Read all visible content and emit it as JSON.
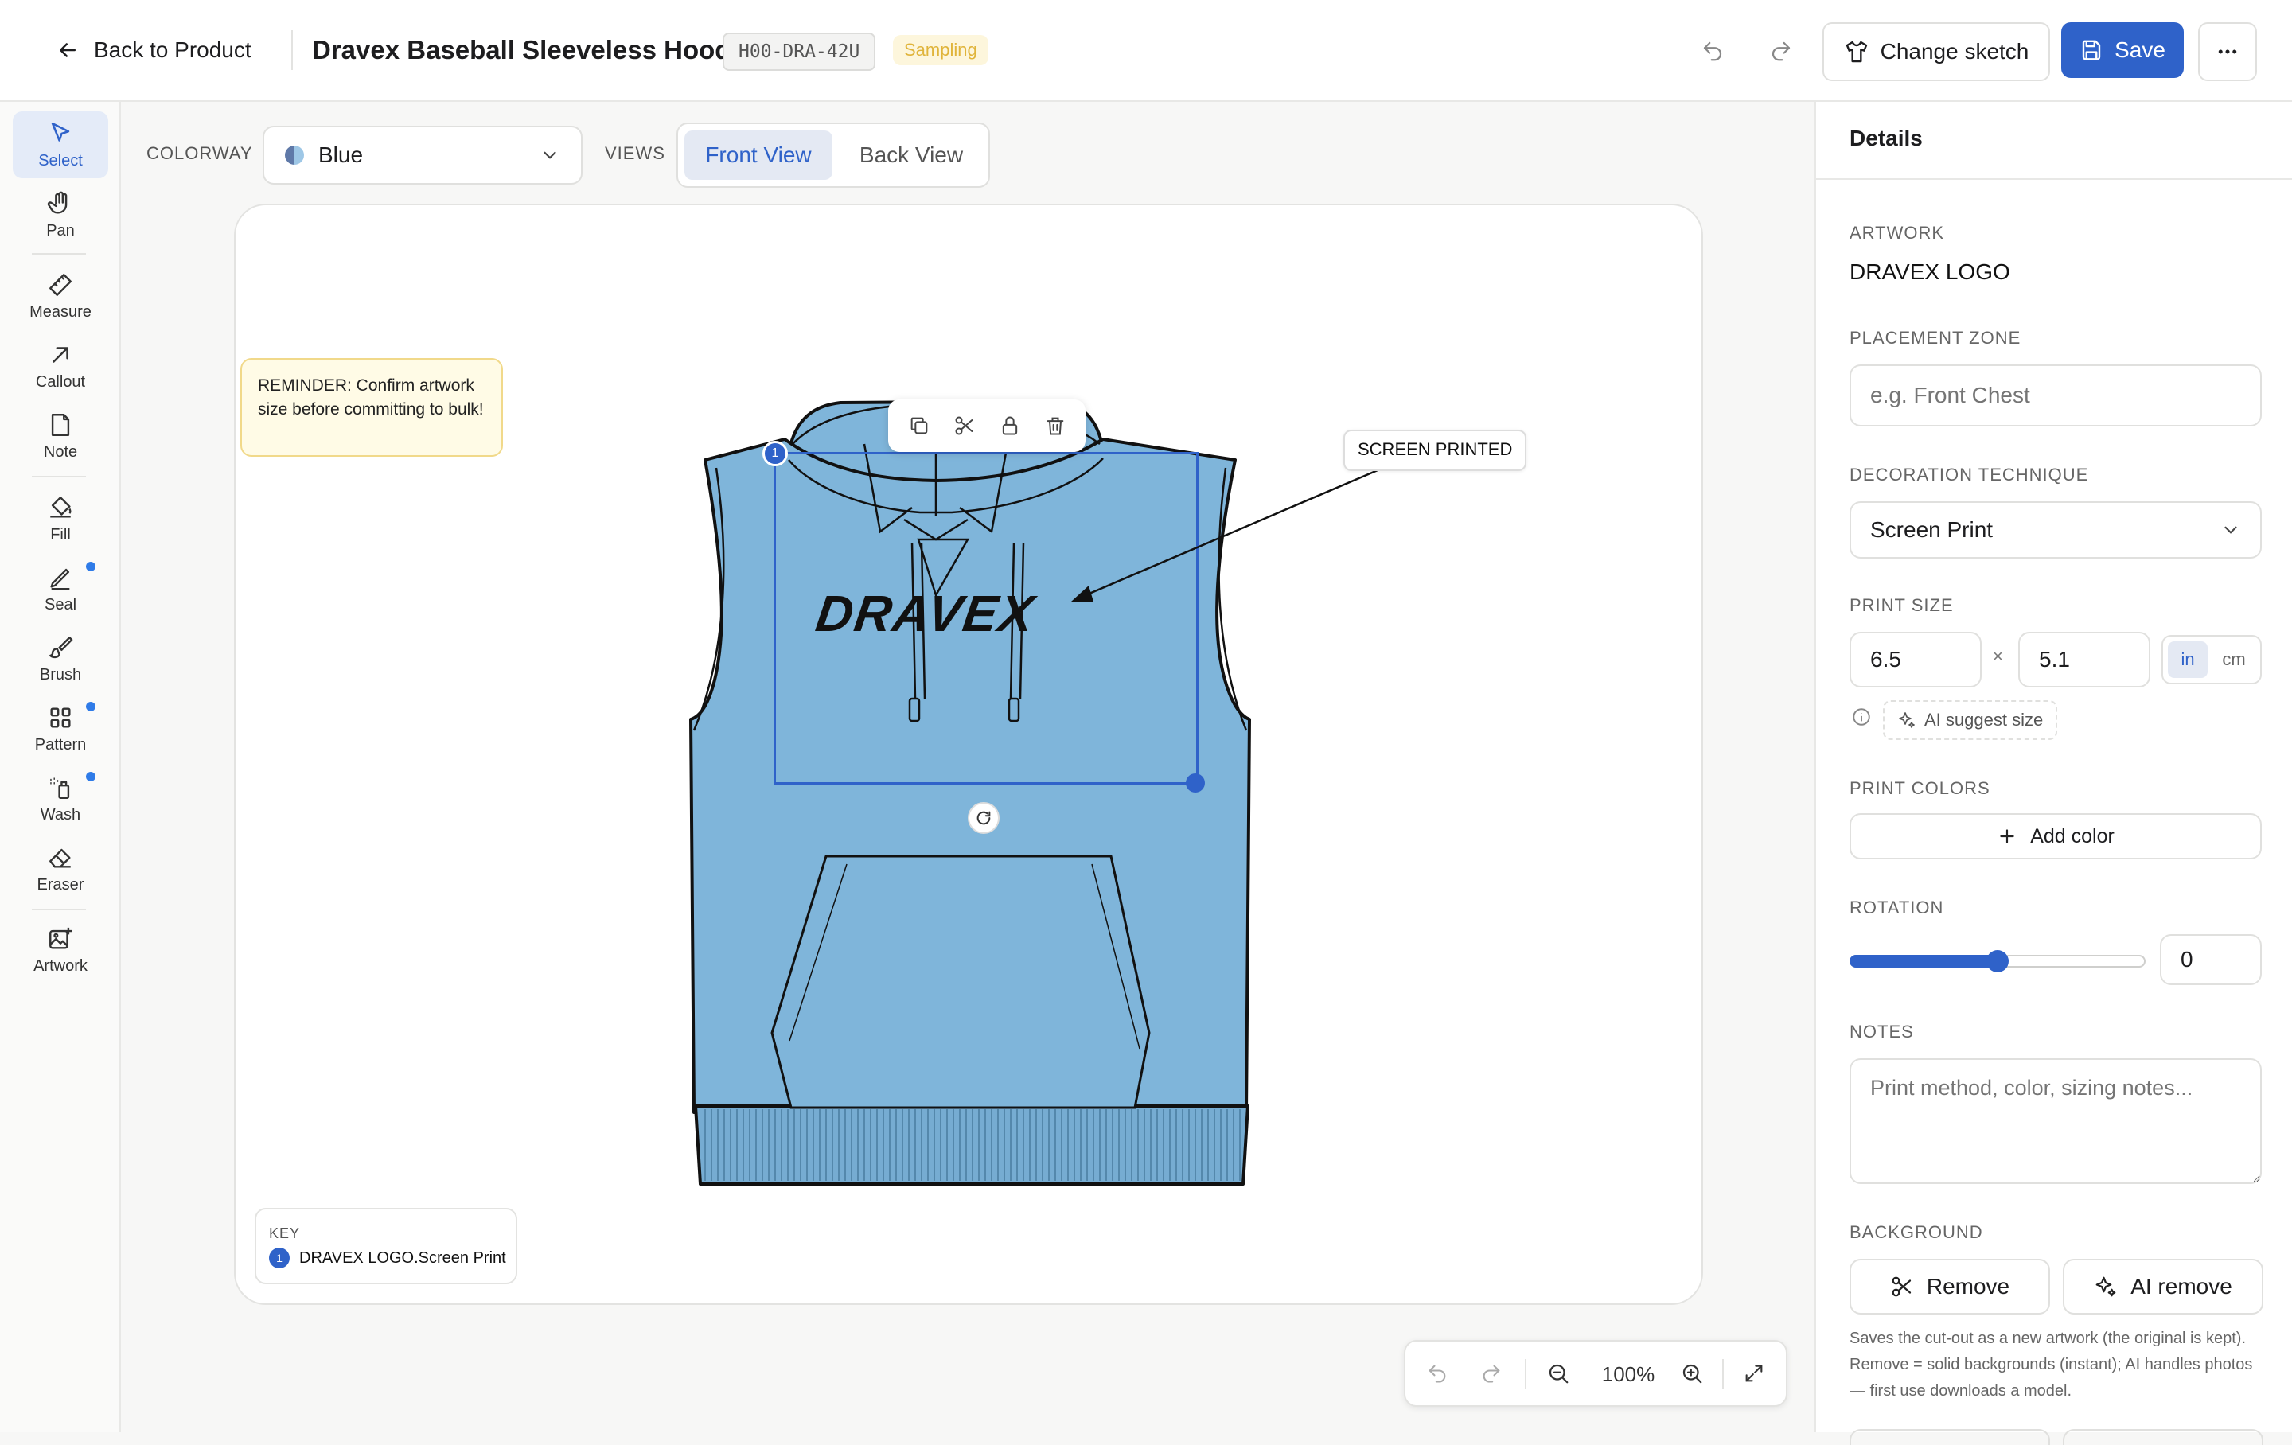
{
  "header": {
    "back_label": "Back to Product",
    "title": "Dravex Baseball Sleeveless Hoodie",
    "sku": "H00-DRA-42U",
    "status": "Sampling",
    "change_sketch_label": "Change sketch",
    "save_label": "Save"
  },
  "toolbar": {
    "tools": [
      {
        "label": "Select",
        "icon": "cursor-icon"
      },
      {
        "label": "Pan",
        "icon": "hand-icon"
      },
      {
        "label": "Measure",
        "icon": "ruler-icon"
      },
      {
        "label": "Callout",
        "icon": "arrow-icon"
      },
      {
        "label": "Note",
        "icon": "note-icon"
      },
      {
        "label": "Fill",
        "icon": "paint-bucket-icon"
      },
      {
        "label": "Seal",
        "icon": "pen-icon"
      },
      {
        "label": "Brush",
        "icon": "brush-icon"
      },
      {
        "label": "Pattern",
        "icon": "grid-icon"
      },
      {
        "label": "Wash",
        "icon": "spray-icon"
      },
      {
        "label": "Eraser",
        "icon": "eraser-icon"
      },
      {
        "label": "Artwork",
        "icon": "image-plus-icon"
      }
    ]
  },
  "controls": {
    "colorway_label": "COLORWAY",
    "colorway_value": "Blue",
    "views_label": "VIEWS",
    "views": [
      "Front View",
      "Back View"
    ],
    "active_view": "Front View"
  },
  "canvas": {
    "reminder": "REMINDER: Confirm artwork size before committing to bulk!",
    "callout": "SCREEN PRINTED",
    "artwork_text": "DRAVEX",
    "marker_number": "1",
    "key_title": "KEY",
    "key_number": "1",
    "key_item": "DRAVEX LOGO.Screen Print",
    "zoom": "100%"
  },
  "details": {
    "title": "Details",
    "artwork_label": "ARTWORK",
    "artwork_name": "DRAVEX LOGO",
    "placement_label": "PLACEMENT ZONE",
    "placement_placeholder": "e.g. Front Chest",
    "technique_label": "DECORATION TECHNIQUE",
    "technique_value": "Screen Print",
    "print_size_label": "PRINT SIZE",
    "width": "6.5",
    "height": "5.1",
    "times": "×",
    "unit_in": "in",
    "unit_cm": "cm",
    "ai_suggest": "AI suggest size",
    "print_colors_label": "PRINT COLORS",
    "add_color": "Add color",
    "rotation_label": "ROTATION",
    "rotation_value": "0",
    "rotation_slider_level": 0.5,
    "notes_label": "NOTES",
    "notes_placeholder": "Print method, color, sizing notes...",
    "background_label": "BACKGROUND",
    "remove_label": "Remove",
    "ai_remove_label": "AI remove",
    "background_help": "Saves the cut-out as a new artwork (the original is kept). Remove = solid backgrounds (instant); AI handles photos — first use downloads a model."
  },
  "colors": {
    "accent": "#2f62c9",
    "garment": "#7fb5da",
    "status_bg": "#fdf6dc",
    "status_text": "#e0b43a",
    "reminder_bg": "#fffbe6"
  }
}
